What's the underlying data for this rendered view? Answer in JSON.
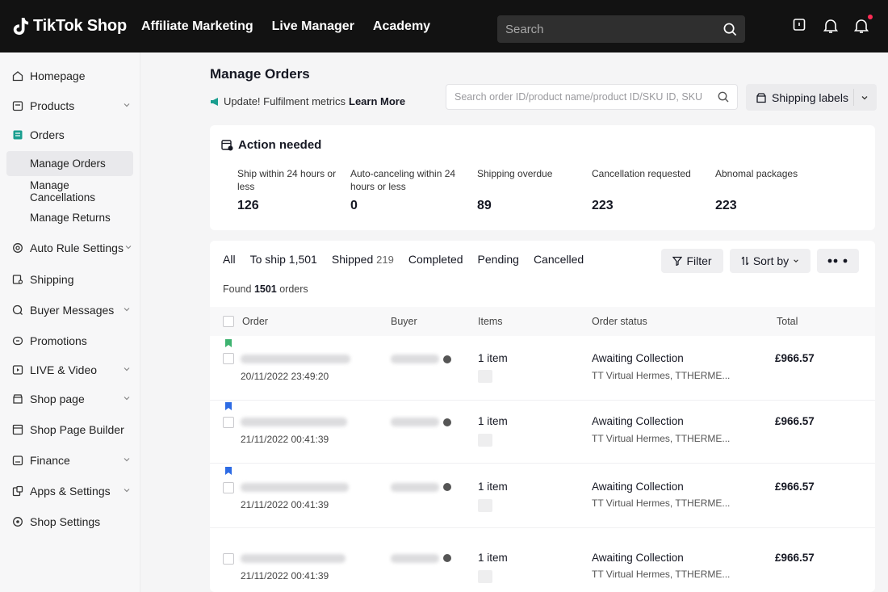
{
  "header": {
    "brand": "TikTok Shop",
    "nav": [
      "Affiliate Marketing",
      "Live Manager",
      "Academy"
    ],
    "search_placeholder": "Search"
  },
  "sidebar": {
    "items": [
      {
        "label": "Homepage",
        "icon": "home-icon",
        "chevron": false
      },
      {
        "label": "Products",
        "icon": "box-icon",
        "chevron": true
      },
      {
        "label": "Orders",
        "icon": "orders-icon",
        "chevron": false
      },
      {
        "label": "Auto Rule Settings",
        "icon": "gear-icon",
        "chevron": true
      },
      {
        "label": "Shipping",
        "icon": "truck-icon",
        "chevron": false
      },
      {
        "label": "Buyer Messages",
        "icon": "chat-icon",
        "chevron": true
      },
      {
        "label": "Promotions",
        "icon": "promo-icon",
        "chevron": false
      },
      {
        "label": "LIVE & Video",
        "icon": "video-icon",
        "chevron": true
      },
      {
        "label": "Shop page",
        "icon": "shop-icon",
        "chevron": true
      },
      {
        "label": "Shop Page Builder",
        "icon": "builder-icon",
        "chevron": false
      },
      {
        "label": "Finance",
        "icon": "finance-icon",
        "chevron": true
      },
      {
        "label": "Apps & Settings",
        "icon": "apps-icon",
        "chevron": true
      },
      {
        "label": "Shop Settings",
        "icon": "settings-icon",
        "chevron": false
      }
    ],
    "orders_sub": [
      "Manage Orders",
      "Manage Cancellations",
      "Manage Returns"
    ]
  },
  "page": {
    "title": "Manage Orders",
    "update_text": "Update! Fulfilment metrics",
    "learn_more": "Learn More",
    "order_search_placeholder": "Search order ID/product name/product ID/SKU ID, SKU",
    "shipping_labels": "Shipping labels"
  },
  "action_needed": {
    "title": "Action needed",
    "metrics": [
      {
        "label": "Ship within 24 hours or less",
        "value": "126"
      },
      {
        "label": "Auto-canceling within 24 hours or less",
        "value": "0"
      },
      {
        "label": "Shipping overdue",
        "value": "89"
      },
      {
        "label": "Cancellation requested",
        "value": "223"
      },
      {
        "label": "Abnomal packages",
        "value": "223"
      }
    ]
  },
  "orders": {
    "tabs": [
      {
        "label": "All",
        "count": ""
      },
      {
        "label": "To ship 1,501",
        "count": ""
      },
      {
        "label": "Shipped",
        "count": "219"
      },
      {
        "label": "Completed",
        "count": ""
      },
      {
        "label": "Pending",
        "count": ""
      },
      {
        "label": "Cancelled",
        "count": ""
      }
    ],
    "filter": "Filter",
    "sort_by": "Sort by",
    "found_prefix": "Found",
    "found_count": "1501",
    "found_suffix": "orders",
    "columns": [
      "Order",
      "Buyer",
      "Items",
      "Order status",
      "Total"
    ],
    "rows": [
      {
        "date": "20/11/2022 23:49:20",
        "items": "1 item",
        "status": "Awaiting Collection",
        "carrier": "TT Virtual Hermes, TTHERME...",
        "total": "£966.57",
        "flag_color": "#3eb370"
      },
      {
        "date": "21/11/2022 00:41:39",
        "items": "1 item",
        "status": "Awaiting Collection",
        "carrier": "TT Virtual Hermes, TTHERME...",
        "total": "£966.57",
        "flag_color": "#2d6be4"
      },
      {
        "date": "21/11/2022 00:41:39",
        "items": "1 item",
        "status": "Awaiting Collection",
        "carrier": "TT Virtual Hermes, TTHERME...",
        "total": "£966.57",
        "flag_color": "#2d6be4"
      },
      {
        "date": "21/11/2022 00:41:39",
        "items": "1 item",
        "status": "Awaiting Collection",
        "carrier": "TT Virtual Hermes, TTHERME...",
        "total": "£966.57",
        "flag_color": ""
      }
    ]
  },
  "colors": {
    "topbar": "#121212",
    "accent_red": "#fe2c55",
    "orders_icon": "#1a9e8f"
  }
}
